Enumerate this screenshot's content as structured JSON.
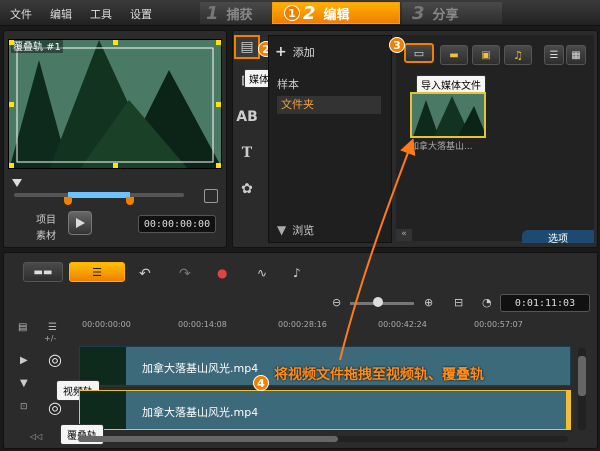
{
  "menu": [
    "文件",
    "编辑",
    "工具",
    "设置"
  ],
  "steps": [
    {
      "num": "1",
      "label": "捕获"
    },
    {
      "num": "2",
      "label": "编辑"
    },
    {
      "num": "3",
      "label": "分享"
    }
  ],
  "preview": {
    "title": "覆叠轨 #1",
    "project_label": "项目",
    "clip_label": "素材",
    "timecode": "00:00:00:00"
  },
  "library": {
    "add_label": "添加",
    "tooltip_media": "媒体",
    "folders": [
      "样本",
      "文件夹"
    ],
    "browse_label": "浏览",
    "import_tooltip": "导入媒体文件",
    "thumb_caption": "加拿大落基山...",
    "options_label": "选项"
  },
  "badges": [
    "1",
    "2",
    "3",
    "4"
  ],
  "timeline": {
    "total_time": "0:01:11:03",
    "ruler_ticks": [
      "00:00:00:00",
      "00:00:14:08",
      "00:00:28:16",
      "00:00:42:24",
      "00:00:57:07"
    ],
    "video_clip": "加拿大落基山风光.mp4",
    "overlay_clip": "加拿大落基山风光.mp4",
    "video_track_label": "视频轨",
    "overlay_track_label": "覆叠轨",
    "instruction": "将视频文件拖拽至视频轨、覆叠轨"
  },
  "colors": {
    "accent": "#f08000",
    "instruction": "#ff8c1a",
    "clip": "#3d6a7a"
  }
}
